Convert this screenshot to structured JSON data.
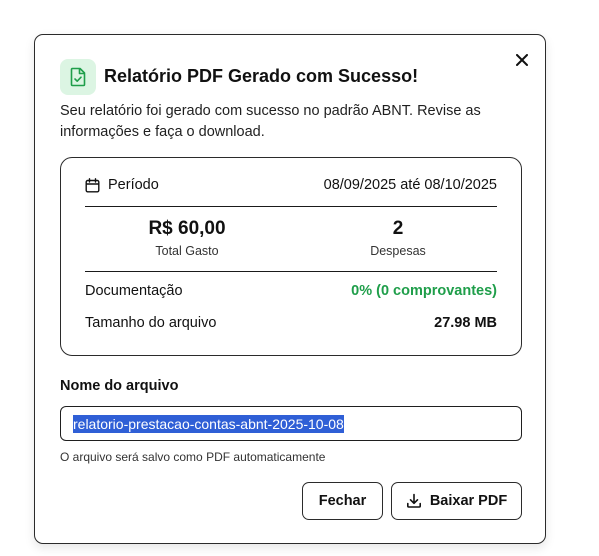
{
  "dialog": {
    "title": "Relatório PDF Gerado com Sucesso!",
    "description": "Seu relatório foi gerado com sucesso no padrão ABNT. Revise as informações e faça o download.",
    "title_icon": "file-check-icon",
    "close_icon": "close-icon"
  },
  "summary": {
    "period_label": "Período",
    "period_value": "08/09/2025 até 08/10/2025",
    "total_value": "R$ 60,00",
    "total_label": "Total Gasto",
    "expenses_value": "2",
    "expenses_label": "Despesas",
    "documentation_label": "Documentação",
    "documentation_value": "0% (0 comprovantes)",
    "file_size_label": "Tamanho do arquivo",
    "file_size_value": "27.98 MB"
  },
  "file_name": {
    "label": "Nome do arquivo",
    "value": "relatorio-prestacao-contas-abnt-2025-10-08",
    "hint": "O arquivo será salvo como PDF automaticamente"
  },
  "actions": {
    "close_label": "Fechar",
    "download_label": "Baixar PDF",
    "download_icon": "download-icon"
  },
  "colors": {
    "accent_green": "#1f9e4a",
    "icon_bg": "#dcf5e3",
    "selection": "#2f5fd6"
  }
}
